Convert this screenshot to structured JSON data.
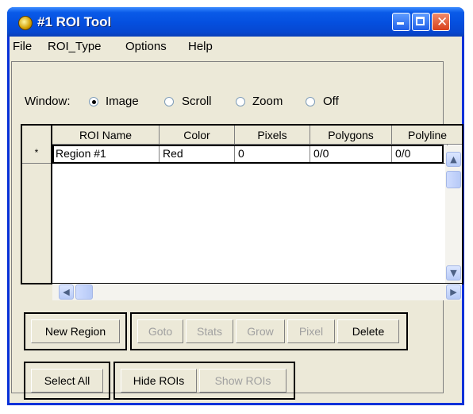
{
  "window": {
    "title": "#1 ROI Tool"
  },
  "menu": [
    "File",
    "ROI_Type",
    "Options",
    "Help"
  ],
  "radio": {
    "label": "Window:",
    "options": [
      "Image",
      "Scroll",
      "Zoom",
      "Off"
    ],
    "selected": "Image"
  },
  "table": {
    "columns": [
      "ROI Name",
      "Color",
      "Pixels",
      "Polygons",
      "Polyline"
    ],
    "row_marker": "*",
    "rows": [
      [
        "Region #1",
        "Red",
        "0",
        "0/0",
        "0/0"
      ]
    ]
  },
  "buttons": {
    "new_region": "New Region",
    "goto": "Goto",
    "stats": "Stats",
    "grow": "Grow",
    "pixel": "Pixel",
    "delete": "Delete",
    "select_all": "Select All",
    "hide_rois": "Hide ROIs",
    "show_rois": "Show ROIs"
  },
  "icons": {
    "app": "idl-app-icon",
    "minimize": "minimize-icon",
    "maximize": "maximize-icon",
    "close": "close-icon"
  },
  "colors": {
    "titlebar": "#0550e0",
    "close_button": "#d8401a",
    "face": "#ece9d8"
  }
}
